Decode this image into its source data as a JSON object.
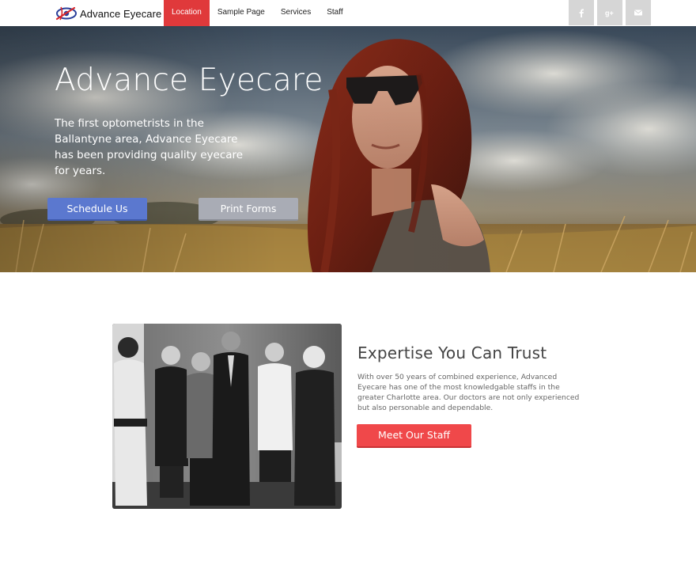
{
  "brand": {
    "name": "Advance Eyecare"
  },
  "nav": {
    "items": [
      {
        "label": "Location",
        "active": true
      },
      {
        "label": "Sample Page",
        "active": false
      },
      {
        "label": "Services",
        "active": false
      },
      {
        "label": "Staff",
        "active": false
      }
    ]
  },
  "social": [
    {
      "icon": "facebook-icon",
      "glyph": "f"
    },
    {
      "icon": "google-plus-icon",
      "glyph": "g+"
    },
    {
      "icon": "mail-icon",
      "glyph": "envelope"
    }
  ],
  "hero": {
    "title": "Advance Eyecare",
    "subtitle": "The first optometrists in the Ballantyne area, Advance Eyecare has been providing quality eyecare for years.",
    "primary_button": "Schedule Us",
    "secondary_button": "Print Forms"
  },
  "content": {
    "title": "Expertise You Can Trust",
    "body": "With over 50 years of combined experience, Advanced Eyecare has one of the most knowledgable staffs in the greater Charlotte area. Our doctors are not only experienced but also personable and dependable.",
    "button": "Meet Our Staff"
  },
  "colors": {
    "accent": "#e0393b",
    "primary_button": "#5b78cf",
    "secondary_button": "#a9acb5",
    "staff_button": "#f0484a"
  }
}
